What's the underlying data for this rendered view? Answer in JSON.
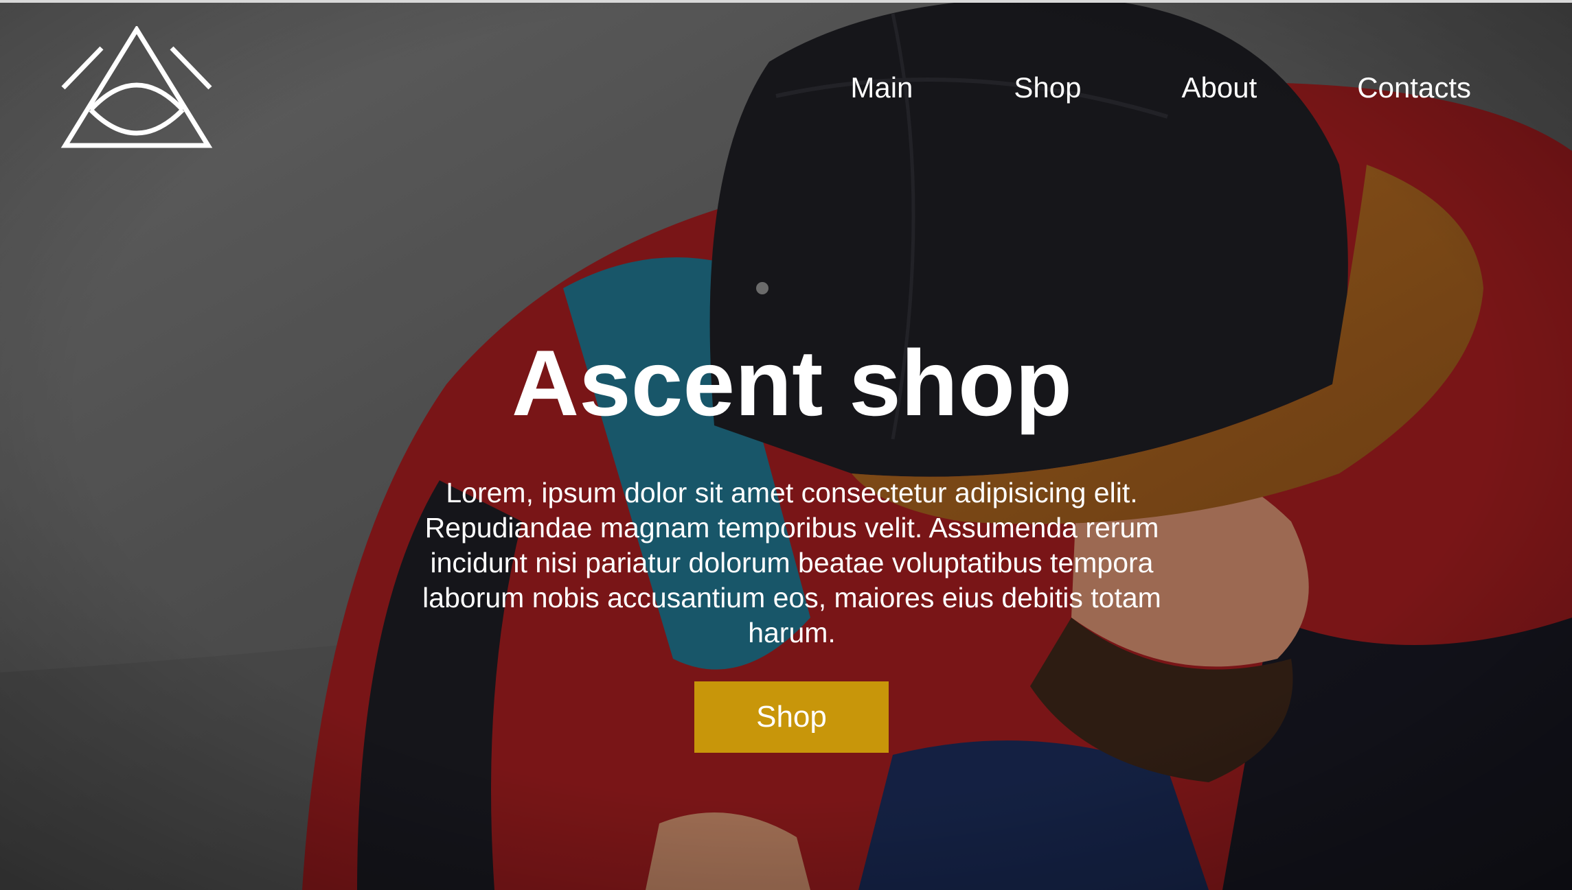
{
  "nav": {
    "items": [
      {
        "label": "Main"
      },
      {
        "label": "Shop"
      },
      {
        "label": "About"
      },
      {
        "label": "Contacts"
      }
    ]
  },
  "hero": {
    "title": "Ascent shop",
    "description": "Lorem, ipsum dolor sit amet consectetur adipisicing elit. Repudiandae magnam temporibus velit. Assumenda rerum incidunt nisi pariatur dolorum beatae voluptatibus tempora laborum nobis accusantium eos, maiores eius debitis totam harum.",
    "cta_label": "Shop"
  },
  "logo": {
    "icon": "triangle-eye-icon"
  },
  "colors": {
    "accent": "#c8960a",
    "text": "#ffffff"
  }
}
